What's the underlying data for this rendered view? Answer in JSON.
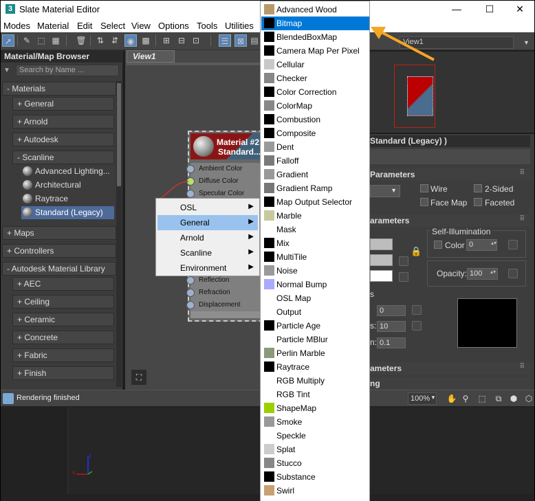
{
  "title": "Slate Material Editor",
  "window_controls": {
    "minimize": "—",
    "maximize": "☐",
    "close": "✕"
  },
  "menu": [
    "Modes",
    "Material",
    "Edit",
    "Select",
    "View",
    "Options",
    "Tools",
    "Utilities"
  ],
  "browser": {
    "title": "Material/Map Browser",
    "search_placeholder": "Search by Name ...",
    "materials_header": "- Materials",
    "materials_groups": [
      "+ General",
      "+ Arnold",
      "+ Autodesk"
    ],
    "scanline_header": "- Scanline",
    "scanline_items": [
      "Advanced Lighting...",
      "Architectural",
      "Raytrace",
      "Standard (Legacy)"
    ],
    "maps_header": "+ Maps",
    "controllers_header": "+ Controllers",
    "autodesk_lib_header": "- Autodesk Material Library",
    "autodesk_lib_items": [
      "+ AEC",
      "+ Ceiling",
      "+ Ceramic",
      "+ Concrete",
      "+ Fabric",
      "+ Finish"
    ]
  },
  "view": {
    "tab": "View1",
    "node": {
      "title1": "Material #2",
      "title2": "Standard...",
      "slots": [
        "Ambient Color",
        "Diffuse Color",
        "Specular Color"
      ],
      "slots_lower": [
        "Reflection",
        "Refraction",
        "Displacement"
      ]
    }
  },
  "context_menu": {
    "items": [
      "OSL",
      "General",
      "Arnold",
      "Scanline",
      "Environment"
    ],
    "highlighted": "General"
  },
  "dropdown": {
    "items": [
      "Advanced Wood",
      "Bitmap",
      "BlendedBoxMap",
      "Camera Map Per Pixel",
      "Cellular",
      "Checker",
      "Color Correction",
      "ColorMap",
      "Combustion",
      "Composite",
      "Dent",
      "Falloff",
      "Gradient",
      "Gradient Ramp",
      "Map Output Selector",
      "Marble",
      "Mask",
      "Mix",
      "MultiTile",
      "Noise",
      "Normal Bump",
      "OSL Map",
      "Output",
      "Particle Age",
      "Particle MBlur",
      "Perlin Marble",
      "Raytrace",
      "RGB Multiply",
      "RGB Tint",
      "ShapeMap",
      "Smoke",
      "Speckle",
      "Splat",
      "Stucco",
      "Substance",
      "Swirl"
    ],
    "swatches": [
      "#b89a6a",
      "#000000",
      "#000000",
      "#000000",
      "#c8c8c8",
      "#888888",
      "#000000",
      "#888888",
      "#000000",
      "#000000",
      "#9a9a9a",
      "#7a7a7a",
      "#999999",
      "#777777",
      "#000000",
      "#c9c9a0",
      "#ffffff",
      "#000000",
      "#000000",
      "#9a9a9a",
      "#aaaaff",
      "#ffffff",
      "#ffffff",
      "#000000",
      "#ffffff",
      "#8a9a7a",
      "#000000",
      "#ffffff",
      "#ffffff",
      "#9ad000",
      "#999999",
      "#ffffff",
      "#cccccc",
      "#888888",
      "#000000",
      "#c9a070"
    ],
    "highlighted": "Bitmap"
  },
  "right": {
    "view_name": "View1",
    "props_title": "Standard (Legacy) )",
    "parameters_header": "Parameters",
    "wire": "Wire",
    "two_sided": "2-Sided",
    "face_map": "Face Map",
    "faceted": "Faceted",
    "parameters2_header": "arameters",
    "self_illum": "Self-Illumination",
    "color_label": "Color",
    "color_value": "0",
    "opacity_label": "Opacity:",
    "opacity_value": "100",
    "s_label": "s",
    "spin1": "0",
    "spin2": "10",
    "spin3": "0.1",
    "frag1": "s:",
    "frag2": "n:",
    "rollout3": "ameters",
    "rollout4": "ng"
  },
  "status": {
    "text": "Rendering finished",
    "zoom": "100%"
  },
  "accent": "#0078d7",
  "arrow_color": "#f5a623"
}
